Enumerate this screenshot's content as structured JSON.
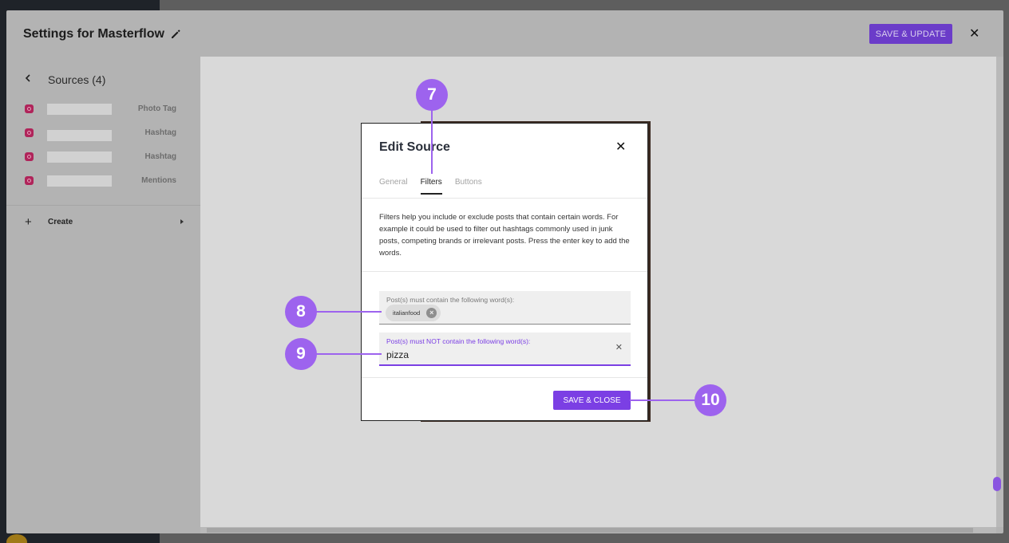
{
  "settings": {
    "title": "Settings for Masterflow",
    "save_update_label": "SAVE & UPDATE"
  },
  "sidebar": {
    "sources_title": "Sources (4)",
    "sources": [
      {
        "type": "Photo Tag"
      },
      {
        "type": "Hashtag"
      },
      {
        "type": "Hashtag"
      },
      {
        "type": "Mentions"
      }
    ],
    "create_label": "Create"
  },
  "modal": {
    "title": "Edit Source",
    "tabs": [
      {
        "label": "General"
      },
      {
        "label": "Filters"
      },
      {
        "label": "Buttons"
      }
    ],
    "description": "Filters help you include or exclude posts that contain certain words. For example it could be used to filter out hashtags commonly used in junk posts, competing brands or irrelevant posts. Press the enter key to add the words.",
    "include_field": {
      "label": "Post(s) must contain the following word(s):",
      "chips": [
        "italianfood"
      ]
    },
    "exclude_field": {
      "label": "Post(s) must NOT contain the following word(s):",
      "value": "pizza"
    },
    "save_close_label": "SAVE & CLOSE"
  },
  "callouts": [
    "7",
    "8",
    "9",
    "10"
  ],
  "colors": {
    "accent": "#7b3fe4",
    "callout": "#9d63ee",
    "instagram": "#b0245a"
  }
}
